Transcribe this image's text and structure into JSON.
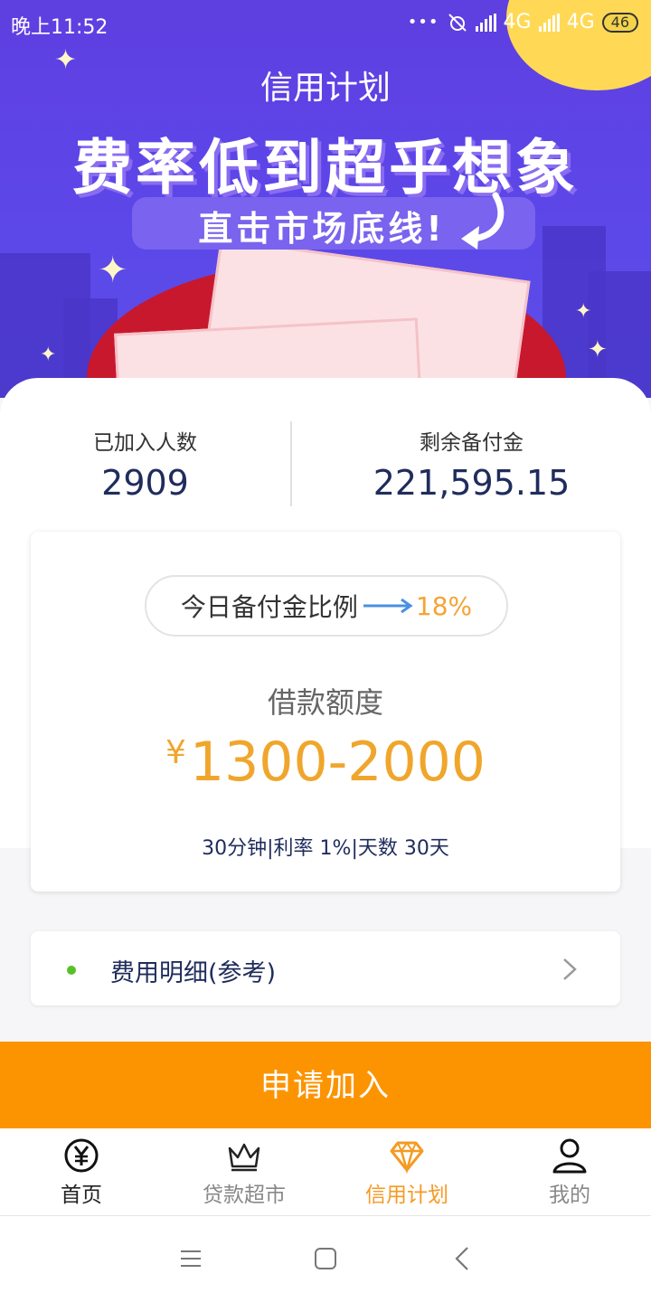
{
  "status_bar": {
    "time": "晚上11:52",
    "dots": "•••",
    "network1": "4G",
    "network2": "4G",
    "battery": "46"
  },
  "header": {
    "title": "信用计划",
    "headline": "费率低到超乎想象",
    "subline": "直击市场底线!"
  },
  "stats": [
    {
      "label": "已加入人数",
      "value": "2909"
    },
    {
      "label": "剩余备付金",
      "value": "221,595.15"
    }
  ],
  "loan": {
    "ratio_label": "今日备付金比例",
    "ratio_value": "18%",
    "title": "借款额度",
    "currency": "¥",
    "amount": "1300-2000",
    "terms": "30分钟|利率 1%|天数 30天"
  },
  "fee_row": {
    "label": "费用明细(参考)"
  },
  "apply_button": "申请加入",
  "tabs": [
    {
      "label": "首页",
      "icon": "yen-icon",
      "active": false
    },
    {
      "label": "贷款超市",
      "icon": "crown-icon",
      "active": false
    },
    {
      "label": "信用计划",
      "icon": "diamond-icon",
      "active": true
    },
    {
      "label": "我的",
      "icon": "user-icon",
      "active": false
    }
  ],
  "colors": {
    "accent": "#fc9402",
    "amount": "#f0a62c",
    "hero": "#5d45e8",
    "navy": "#1f2c5c",
    "tab_active": "#f59a23"
  }
}
